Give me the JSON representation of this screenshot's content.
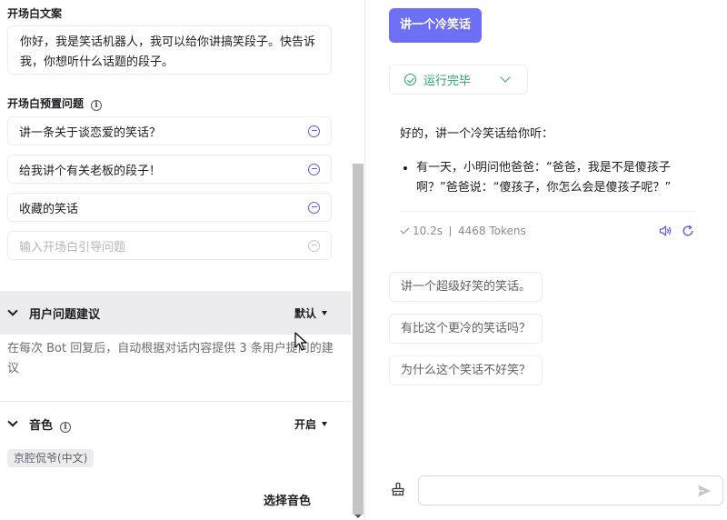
{
  "left_panel": {
    "opening_title": "开场白文案",
    "opening_text": "你好，我是笑话机器人，我可以给你讲搞笑段子。快告诉我，你想听什么话题的段子。",
    "preset_title": "开场白预置问题",
    "preset_questions": [
      "讲一条关于谈恋爱的笑话？",
      "给我讲个有关老板的段子！",
      "收藏的笑话"
    ],
    "preset_placeholder": "输入开场白引导问题",
    "suggest_section": {
      "title": "用户问题建议",
      "mode": "默认",
      "description": "在每次 Bot 回复后，自动根据对话内容提供 3 条用户提问的建议"
    },
    "voice_section": {
      "title": "音色",
      "state": "开启",
      "tag": "京腔侃爷(中文)",
      "select_button": "选择音色"
    }
  },
  "chat": {
    "user_message": "讲一个冷笑话",
    "run_status": "运行完毕",
    "answer_intro": "好的，讲一个冷笑话给你听：",
    "answer_items": [
      "有一天，小明问他爸爸：“爸爸，我是不是傻孩子啊？”爸爸说：“傻孩子，你怎么会是傻孩子呢？”"
    ],
    "meta": {
      "time": "10.2s",
      "tokens": "4468 Tokens"
    },
    "suggestions": [
      "讲一个超级好笑的笑话。",
      "有比这个更冷的笑话吗？",
      "为什么这个笑话不好笑？"
    ],
    "input_value": ""
  },
  "colors": {
    "accent": "#6d6ff5",
    "minus_icon": "#5b5cf0",
    "success": "#2ea36b",
    "header_bg": "#ebebef"
  }
}
